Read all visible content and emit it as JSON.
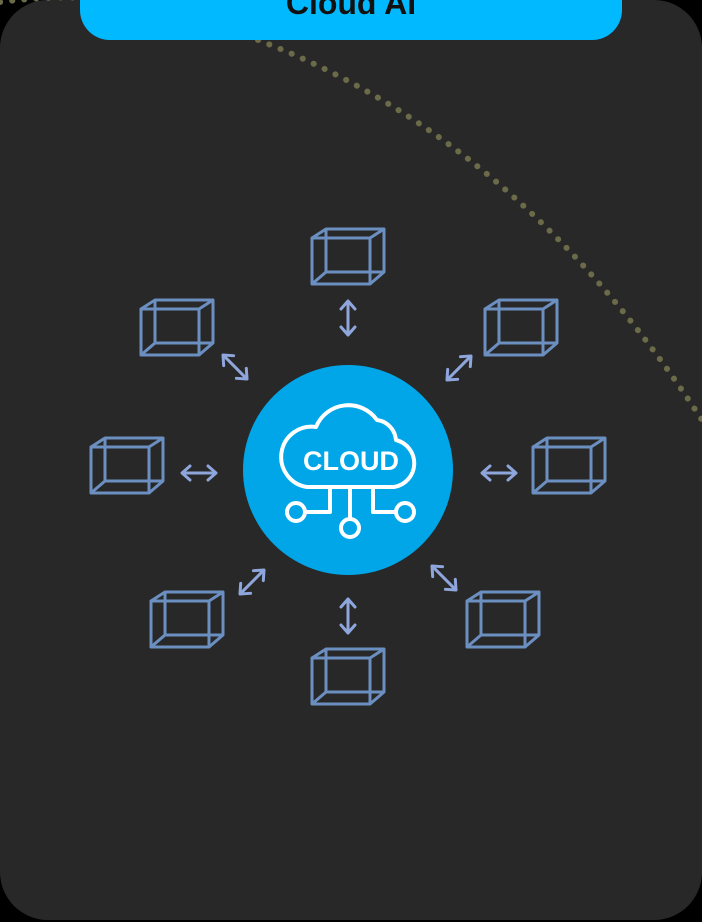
{
  "title": "Cloud AI",
  "hub": {
    "label": "CLOUD",
    "icon": "cloud-network-icon"
  },
  "nodes": [
    {
      "id": "top",
      "icon": "cube-icon",
      "arrow": "double-arrow-icon"
    },
    {
      "id": "top-right",
      "icon": "cube-icon",
      "arrow": "double-arrow-icon"
    },
    {
      "id": "right",
      "icon": "cube-icon",
      "arrow": "double-arrow-icon"
    },
    {
      "id": "bottom-right",
      "icon": "cube-icon",
      "arrow": "double-arrow-icon"
    },
    {
      "id": "bottom",
      "icon": "cube-icon",
      "arrow": "double-arrow-icon"
    },
    {
      "id": "bottom-left",
      "icon": "cube-icon",
      "arrow": "double-arrow-icon"
    },
    {
      "id": "left",
      "icon": "cube-icon",
      "arrow": "double-arrow-icon"
    },
    {
      "id": "top-left",
      "icon": "cube-icon",
      "arrow": "double-arrow-icon"
    }
  ],
  "colors": {
    "background": "#000000",
    "card": "#282828",
    "accent": "#00b9ff",
    "hub": "#00a6e8",
    "cube_stroke": "#6b8fc0",
    "arrow": "#8fa6dd",
    "dotted_curve": "#6b6b4a"
  }
}
